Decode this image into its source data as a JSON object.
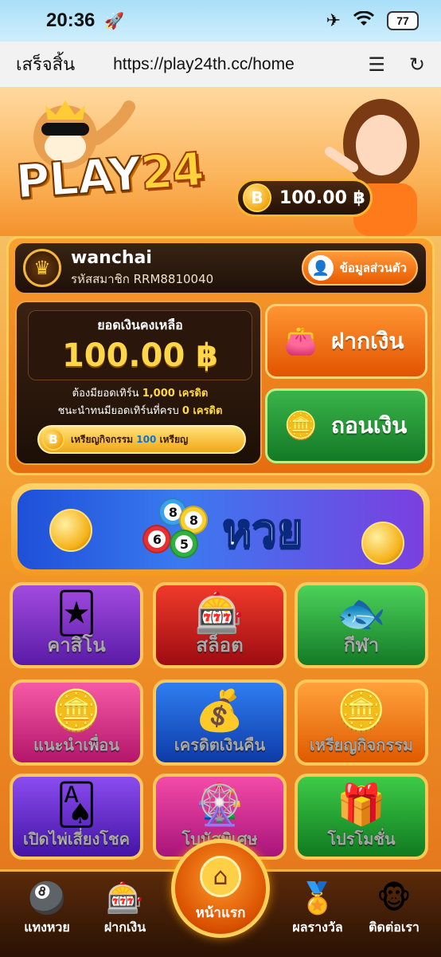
{
  "status_bar": {
    "time": "20:36",
    "battery": "77"
  },
  "browser": {
    "done_label": "เสร็จสิ้น",
    "url": "https://play24th.cc/home"
  },
  "header": {
    "logo_play": "PLAY",
    "logo_num": "24",
    "balance": "100.00 ฿",
    "coin_symbol": "B"
  },
  "user": {
    "name": "wanchai",
    "member_id": "รหัสสมาชิก RRM8810040",
    "profile_button": "ข้อมูลส่วนตัว"
  },
  "wallet": {
    "label": "ยอดเงินคงเหลือ",
    "amount": "100.00 ฿",
    "turnover_line1_pre": "ต้องมียอดเทิร์น",
    "turnover_line1_val": "1,000 เครดิต",
    "turnover_line2_pre": "ชนะนำทนมียอดเทิร์นที่ครบ",
    "turnover_line2_val": "0 เครดิต",
    "mission_pre": "เหรียญกิจกรรม",
    "mission_val": "100",
    "mission_post": "เหรียญ"
  },
  "actions": {
    "deposit": "ฝากเงิน",
    "withdraw": "ถอนเงิน"
  },
  "lotto": {
    "title": "หวย",
    "balls": [
      "8",
      "8",
      "6",
      "5"
    ]
  },
  "tiles": [
    {
      "label": "คาสิโน",
      "icon": "casino-cards-icon"
    },
    {
      "label": "สล็อต",
      "icon": "slot-machine-icon"
    },
    {
      "label": "กีฬา",
      "icon": "fish-sport-icon"
    },
    {
      "label": "แนะนำเพื่อน",
      "icon": "chips-icon"
    },
    {
      "label": "เครดิตเงินคืน",
      "icon": "money-bag-icon"
    },
    {
      "label": "เหรียญกิจกรรม",
      "icon": "coin-icon"
    },
    {
      "label": "เปิดไพ่เสี่ยงโชค",
      "icon": "cards-icon"
    },
    {
      "label": "โบนัสพิเศษ",
      "icon": "wheel-icon"
    },
    {
      "label": "โปรโมชั่น",
      "icon": "gift-icon"
    }
  ],
  "nav": {
    "lotto": "แทงหวย",
    "deposit": "ฝากเงิน",
    "home": "หน้าแรก",
    "rewards": "ผลรางวัล",
    "contact": "ติดต่อเรา"
  }
}
